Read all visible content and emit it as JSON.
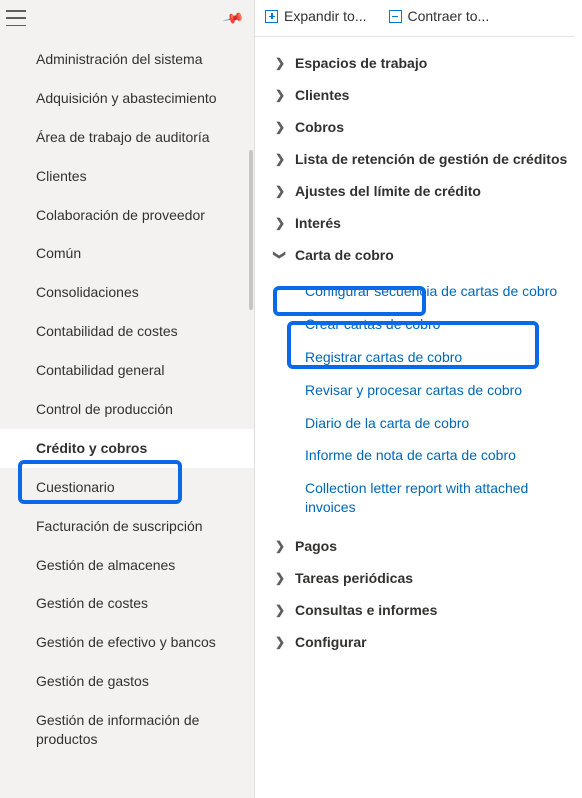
{
  "toolbar": {
    "expand_label": "Expandir to...",
    "collapse_label": "Contraer to..."
  },
  "sidebar": {
    "items": [
      {
        "label": "Administración del sistema"
      },
      {
        "label": "Adquisición y abastecimiento"
      },
      {
        "label": "Área de trabajo de auditoría"
      },
      {
        "label": "Clientes"
      },
      {
        "label": "Colaboración de proveedor"
      },
      {
        "label": "Común"
      },
      {
        "label": "Consolidaciones"
      },
      {
        "label": "Contabilidad de costes"
      },
      {
        "label": "Contabilidad general"
      },
      {
        "label": "Control de producción"
      },
      {
        "label": "Crédito y cobros"
      },
      {
        "label": "Cuestionario"
      },
      {
        "label": "Facturación de suscripción"
      },
      {
        "label": "Gestión de almacenes"
      },
      {
        "label": "Gestión de costes"
      },
      {
        "label": "Gestión de efectivo y bancos"
      },
      {
        "label": "Gestión de gastos"
      },
      {
        "label": "Gestión de información de productos"
      }
    ]
  },
  "tree": {
    "items": [
      {
        "label": "Espacios de trabajo",
        "expanded": false
      },
      {
        "label": "Clientes",
        "expanded": false
      },
      {
        "label": "Cobros",
        "expanded": false
      },
      {
        "label": "Lista de retención de gestión de créditos",
        "expanded": false
      },
      {
        "label": "Ajustes del límite de crédito",
        "expanded": false
      },
      {
        "label": "Interés",
        "expanded": false
      },
      {
        "label": "Carta de cobro",
        "expanded": true,
        "children": [
          {
            "label": "Configurar secuencia de cartas de cobro"
          },
          {
            "label": "Crear cartas de cobro"
          },
          {
            "label": "Registrar cartas de cobro"
          },
          {
            "label": "Revisar y procesar cartas de cobro"
          },
          {
            "label": "Diario de la carta de cobro"
          },
          {
            "label": "Informe de nota de carta de cobro"
          },
          {
            "label": "Collection letter report with attached invoices"
          }
        ]
      },
      {
        "label": "Pagos",
        "expanded": false
      },
      {
        "label": "Tareas periódicas",
        "expanded": false
      },
      {
        "label": "Consultas e informes",
        "expanded": false
      },
      {
        "label": "Configurar",
        "expanded": false
      }
    ]
  }
}
